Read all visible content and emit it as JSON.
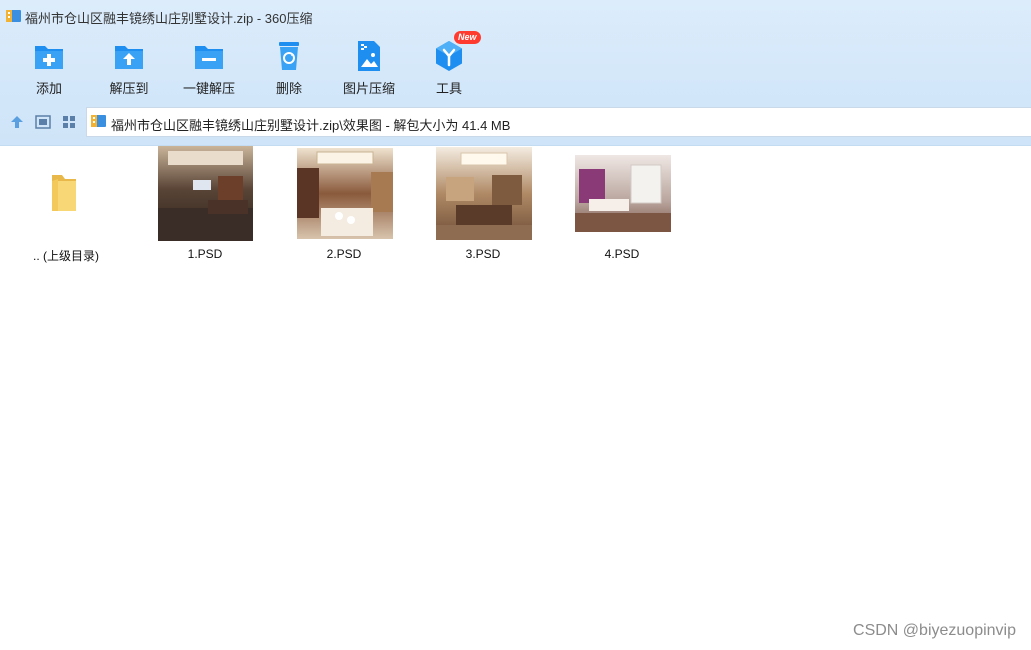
{
  "window": {
    "title": "福州市仓山区融丰镜绣山庄别墅设计.zip - 360压缩"
  },
  "toolbar": {
    "items": [
      {
        "label": "添加",
        "icon": "add-folder-icon"
      },
      {
        "label": "解压到",
        "icon": "extract-folder-icon"
      },
      {
        "label": "一键解压",
        "icon": "one-click-extract-icon"
      },
      {
        "label": "删除",
        "icon": "recycle-bin-icon"
      },
      {
        "label": "图片压缩",
        "icon": "image-compress-icon"
      },
      {
        "label": "工具",
        "icon": "tools-cube-icon",
        "badge": "New"
      }
    ]
  },
  "navbar": {
    "buttons": [
      "up-arrow-icon",
      "detail-view-icon",
      "grid-view-icon"
    ],
    "path": "福州市仓山区融丰镜绣山庄别墅设计.zip\\效果图 - 解包大小为 41.4 MB"
  },
  "files": [
    {
      "name": ".. (上级目录)",
      "type": "parent-folder"
    },
    {
      "name": "1.PSD",
      "type": "image"
    },
    {
      "name": "2.PSD",
      "type": "image"
    },
    {
      "name": "3.PSD",
      "type": "image"
    },
    {
      "name": "4.PSD",
      "type": "image"
    }
  ],
  "watermark": "CSDN @biyezuopinvip",
  "colors": {
    "accent": "#1e8ff0",
    "chrome": "#d6e9fb",
    "badge": "#ff3b30"
  }
}
